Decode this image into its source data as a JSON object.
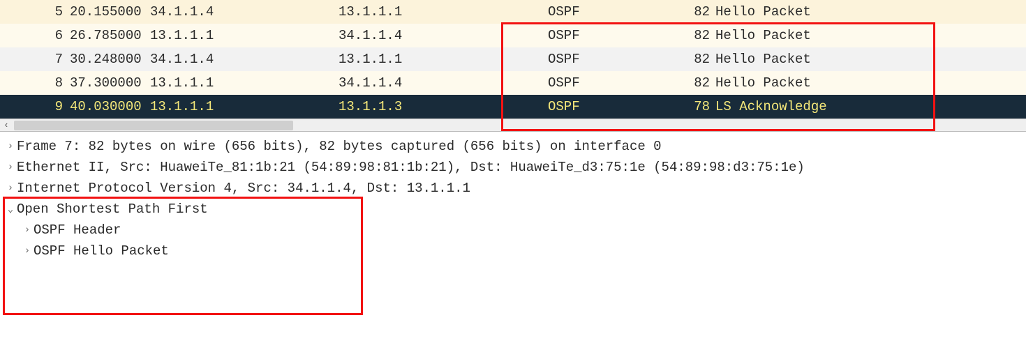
{
  "packets": [
    {
      "no": "5",
      "time": "20.155000",
      "src": "34.1.1.4",
      "dst": "13.1.1.1",
      "proto": "OSPF",
      "len": "82",
      "info": "Hello Packet",
      "style": "even-alt"
    },
    {
      "no": "6",
      "time": "26.785000",
      "src": "13.1.1.1",
      "dst": "34.1.1.4",
      "proto": "OSPF",
      "len": "82",
      "info": "Hello Packet",
      "style": "odd-alt"
    },
    {
      "no": "7",
      "time": "30.248000",
      "src": "34.1.1.4",
      "dst": "13.1.1.1",
      "proto": "OSPF",
      "len": "82",
      "info": "Hello Packet",
      "style": "grey-alt"
    },
    {
      "no": "8",
      "time": "37.300000",
      "src": "13.1.1.1",
      "dst": "34.1.1.4",
      "proto": "OSPF",
      "len": "82",
      "info": "Hello Packet",
      "style": "odd-alt"
    },
    {
      "no": "9",
      "time": "40.030000",
      "src": "13.1.1.1",
      "dst": "13.1.1.3",
      "proto": "OSPF",
      "len": "78",
      "info": "LS Acknowledge",
      "style": "selected"
    }
  ],
  "details": {
    "frame": "Frame 7: 82 bytes on wire (656 bits), 82 bytes captured (656 bits) on interface 0",
    "eth": "Ethernet II, Src: HuaweiTe_81:1b:21 (54:89:98:81:1b:21), Dst: HuaweiTe_d3:75:1e (54:89:98:d3:75:1e)",
    "ip": "Internet Protocol Version 4, Src: 34.1.1.4, Dst: 13.1.1.1",
    "ospf": "Open Shortest Path First",
    "ospf_header": "OSPF Header",
    "ospf_hello": "OSPF Hello Packet"
  },
  "glyphs": {
    "collapsed": "›",
    "expanded": "⌄",
    "scroll_left": "‹"
  }
}
